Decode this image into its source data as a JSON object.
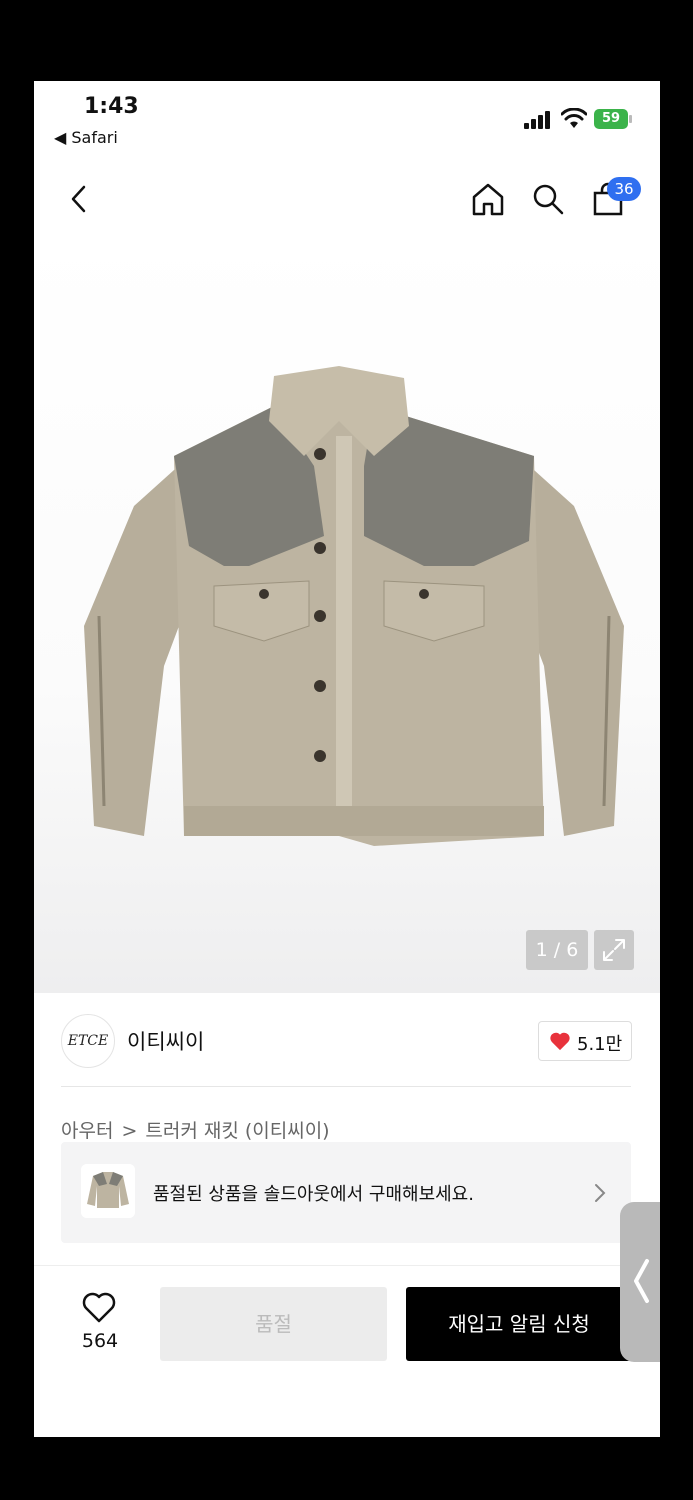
{
  "status_bar": {
    "time": "1:43",
    "back_app": "◀ Safari",
    "battery": "59"
  },
  "nav": {
    "cart_count": "36",
    "icons": [
      "back-icon",
      "home-icon",
      "search-icon",
      "cart-icon"
    ]
  },
  "gallery": {
    "counter": "1 / 6"
  },
  "brand": {
    "logo_text": "ETCE",
    "name": "이티씨이",
    "like_count": "5.1만"
  },
  "breadcrumb": {
    "category": "아우터",
    "separator": ">",
    "product": "트러커 재킷 (이티씨이)"
  },
  "soldout_banner": {
    "message": "품절된 상품을 솔드아웃에서 구매해보세요."
  },
  "bottom_bar": {
    "wish_count": "564",
    "soldout_label": "품절",
    "restock_label": "재입고 알림 신청"
  },
  "colors": {
    "badge": "#2f6ff0",
    "heart": "#e8323c",
    "primary_button": "#000000",
    "disabled_button": "#ececec"
  }
}
